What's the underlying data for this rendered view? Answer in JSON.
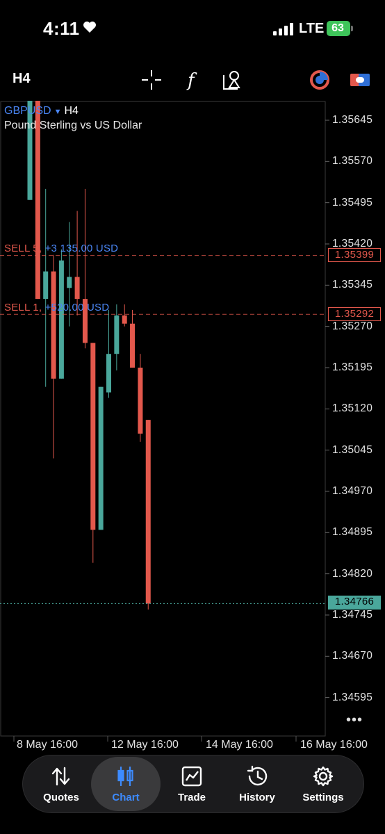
{
  "status_bar": {
    "time": "4:11",
    "network": "LTE",
    "battery": "63"
  },
  "toolbar": {
    "timeframe": "H4",
    "icons": [
      "crosshair-icon",
      "function-icon",
      "objects-icon",
      "theme-toggle-icon",
      "account-icon"
    ]
  },
  "chart": {
    "symbol": "GBPUSD",
    "timeframe": "H4",
    "description": "Pound Sterling vs US Dollar",
    "price_ticks": [
      "1.35645",
      "1.35570",
      "1.35495",
      "1.35420",
      "1.35345",
      "1.35270",
      "1.35195",
      "1.35120",
      "1.35045",
      "1.34970",
      "1.34895",
      "1.34820",
      "1.34745",
      "1.34670",
      "1.34595"
    ],
    "orders": [
      {
        "side": "SELL 5,",
        "profit": "+3 135.00 USD",
        "price": "1.35399"
      },
      {
        "side": "SELL 1,",
        "profit": "+520.00 USD",
        "price": "1.35292"
      }
    ],
    "current_price": "1.34766",
    "time_labels": [
      "8 May 16:00",
      "12 May 16:00",
      "14 May 16:00",
      "16 May 16:00"
    ],
    "more_label": "•••",
    "colors": {
      "bull": "#4aa79b",
      "bear": "#e3584c",
      "link": "#4a86f5"
    }
  },
  "chart_data": {
    "type": "candlestick",
    "title": "GBPUSD, H4",
    "candles": [
      {
        "open": 1.355,
        "high": 1.357,
        "low": 1.355,
        "close": 1.357
      },
      {
        "open": 1.357,
        "high": 1.357,
        "low": 1.3532,
        "close": 1.3532
      },
      {
        "open": 1.3532,
        "high": 1.3552,
        "low": 1.3516,
        "close": 1.3537
      },
      {
        "open": 1.3537,
        "high": 1.354,
        "low": 1.3503,
        "close": 1.35175
      },
      {
        "open": 1.35175,
        "high": 1.3541,
        "low": 1.35175,
        "close": 1.3539
      },
      {
        "open": 1.3534,
        "high": 1.3546,
        "low": 1.3527,
        "close": 1.3536
      },
      {
        "open": 1.3536,
        "high": 1.3548,
        "low": 1.3529,
        "close": 1.3532
      },
      {
        "open": 1.3532,
        "high": 1.3552,
        "low": 1.3523,
        "close": 1.3524
      },
      {
        "open": 1.3524,
        "high": 1.3524,
        "low": 1.3484,
        "close": 1.349
      },
      {
        "open": 1.349,
        "high": 1.3516,
        "low": 1.349,
        "close": 1.3516
      },
      {
        "open": 1.3515,
        "high": 1.353,
        "low": 1.3514,
        "close": 1.3522
      },
      {
        "open": 1.3522,
        "high": 1.3531,
        "low": 1.3519,
        "close": 1.3529
      },
      {
        "open": 1.3529,
        "high": 1.3531,
        "low": 1.3527,
        "close": 1.35275
      },
      {
        "open": 1.35275,
        "high": 1.353,
        "low": 1.35195,
        "close": 1.35195
      },
      {
        "open": 1.35195,
        "high": 1.3522,
        "low": 1.3506,
        "close": 1.35075
      },
      {
        "open": 1.351,
        "high": 1.351,
        "low": 1.34755,
        "close": 1.34766
      }
    ]
  },
  "tabs": [
    {
      "label": "Quotes",
      "icon": "quotes-icon",
      "active": false
    },
    {
      "label": "Chart",
      "icon": "chart-icon",
      "active": true
    },
    {
      "label": "Trade",
      "icon": "trade-icon",
      "active": false
    },
    {
      "label": "History",
      "icon": "history-icon",
      "active": false
    },
    {
      "label": "Settings",
      "icon": "settings-icon",
      "active": false
    }
  ]
}
